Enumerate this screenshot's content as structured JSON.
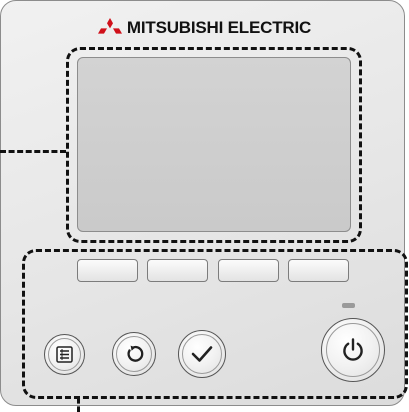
{
  "device": {
    "brand_name": "MITSUBISHI ELECTRIC",
    "logo_icon": "three-diamond-logo-icon",
    "panel_color": "#e6e6e6",
    "callout_color": "#111111"
  },
  "screen": {
    "state": "blank",
    "color": "#cfcfcf"
  },
  "function_buttons": [
    {
      "id": "F1",
      "label": ""
    },
    {
      "id": "F2",
      "label": ""
    },
    {
      "id": "F3",
      "label": ""
    },
    {
      "id": "F4",
      "label": ""
    }
  ],
  "control_buttons": [
    {
      "id": "menu",
      "icon": "menu-icon"
    },
    {
      "id": "return",
      "icon": "return-icon"
    },
    {
      "id": "select",
      "icon": "checkmark-icon"
    },
    {
      "id": "on_off",
      "icon": "power-icon"
    }
  ],
  "indicator_lamp": {
    "state": "off",
    "color": "#9a9a9a"
  }
}
